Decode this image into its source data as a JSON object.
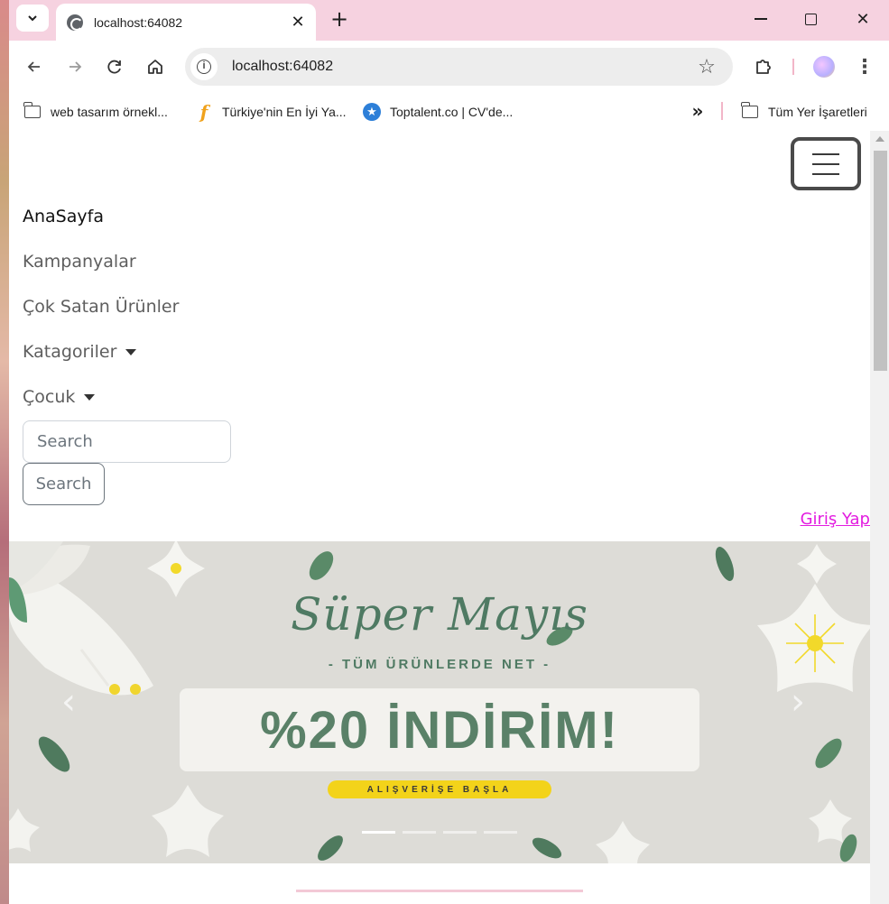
{
  "browser": {
    "tab_title": "localhost:64082",
    "url": "localhost:64082",
    "tab_close": "✕",
    "new_tab": "+",
    "window_close": "✕"
  },
  "bookmarks": {
    "items": [
      {
        "label": "web tasarım örnekl...",
        "icon": "folder-icon"
      },
      {
        "label": "Türkiye'nin En İyi Ya...",
        "icon": "f-logo-icon"
      },
      {
        "label": "Toptalent.co | CV'de...",
        "icon": "star-badge-icon"
      }
    ],
    "more": "»",
    "all_bookmarks": "Tüm Yer İşaretleri"
  },
  "page": {
    "nav": {
      "items": [
        {
          "label": "AnaSayfa",
          "dropdown": false,
          "active": true
        },
        {
          "label": "Kampanyalar",
          "dropdown": false,
          "active": false
        },
        {
          "label": "Çok Satan Ürünler",
          "dropdown": false,
          "active": false
        },
        {
          "label": "Katagoriler",
          "dropdown": true,
          "active": false
        },
        {
          "label": "Çocuk",
          "dropdown": true,
          "active": false
        }
      ]
    },
    "search": {
      "placeholder": "Search",
      "button_label": "Search"
    },
    "login_link": "Giriş Yap",
    "carousel": {
      "headline": "Süper Mayıs",
      "subline": "- TÜM ÜRÜNLERDE NET -",
      "promo": "%20 İNDİRİM!",
      "cta": "ALIŞVERİŞE BAŞLA",
      "prev": "‹",
      "next": "›",
      "indicator_count": 4,
      "active_indicator": 0
    }
  },
  "colors": {
    "link": "#e31ce0",
    "brand_green": "#5a8168",
    "cta_yellow": "#f3d31a",
    "chrome_pink": "#f6d2e0"
  }
}
